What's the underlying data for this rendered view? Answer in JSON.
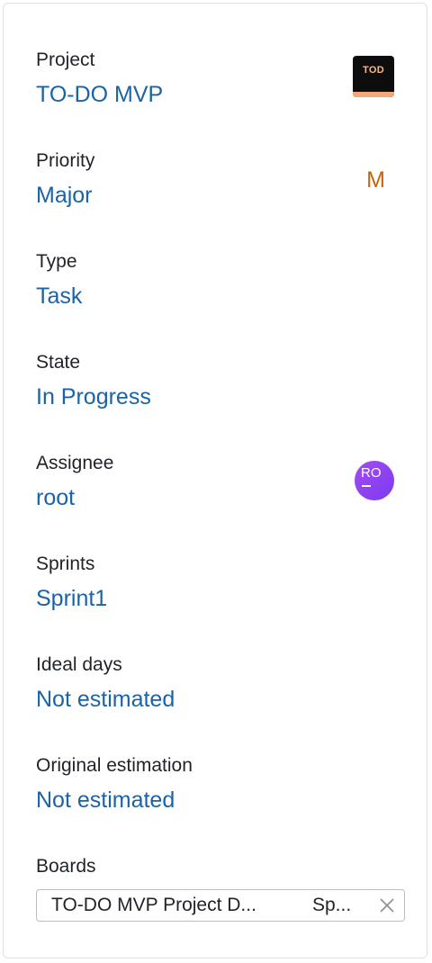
{
  "fields": {
    "project": {
      "label": "Project",
      "value": "TO-DO MVP",
      "icon_text": "TOD",
      "icon": "project-logo-icon"
    },
    "priority": {
      "label": "Priority",
      "value": "Major",
      "badge": "M",
      "badge_color": "#c0670c"
    },
    "type": {
      "label": "Type",
      "value": "Task"
    },
    "state": {
      "label": "State",
      "value": "In Progress"
    },
    "assignee": {
      "label": "Assignee",
      "value": "root",
      "avatar_text": "RO"
    },
    "sprints": {
      "label": "Sprints",
      "value": "Sprint1"
    },
    "ideal_days": {
      "label": "Ideal days",
      "value": "Not estimated"
    },
    "original_estimation": {
      "label": "Original estimation",
      "value": "Not estimated"
    },
    "boards": {
      "label": "Boards",
      "board_name": "TO-DO MVP Project D...",
      "board_sprint": "Sp...",
      "remove_icon": "close-icon"
    }
  },
  "colors": {
    "link": "#1b63a6",
    "border": "#dfe1e5"
  }
}
